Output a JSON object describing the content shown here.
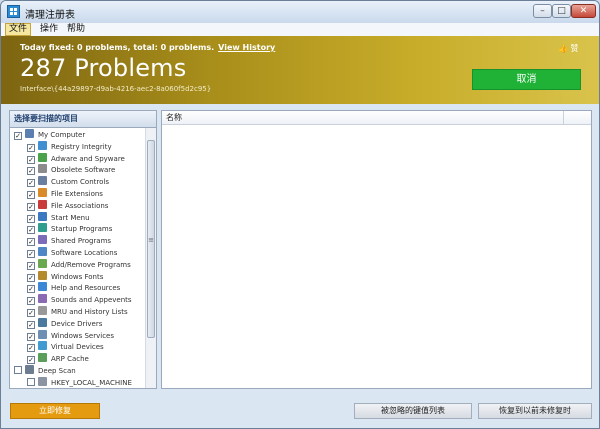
{
  "window": {
    "title": "清理注册表"
  },
  "menu": [
    "文件",
    "操作",
    "帮助"
  ],
  "banner": {
    "today_text": "Today fixed: 0 problems, total: 0 problems.",
    "view_history": "View History",
    "problems": "287 Problems",
    "interface": "Interface\\{44a29897-d9ab-4216-aec2-8a060f5d2c95}",
    "like": "赞",
    "cancel": "取消"
  },
  "left_panel": {
    "header": "选择要扫描的项目",
    "tree": [
      {
        "label": "My Computer",
        "level": 0,
        "checked": true,
        "icon": "computer-icon"
      },
      {
        "label": "Registry Integrity",
        "level": 1,
        "checked": true,
        "icon": "registry-icon"
      },
      {
        "label": "Adware and Spyware",
        "level": 1,
        "checked": true,
        "icon": "bug-icon"
      },
      {
        "label": "Obsolete Software",
        "level": 1,
        "checked": true,
        "icon": "package-icon"
      },
      {
        "label": "Custom Controls",
        "level": 1,
        "checked": true,
        "icon": "control-icon"
      },
      {
        "label": "File Extensions",
        "level": 1,
        "checked": true,
        "icon": "file-icon"
      },
      {
        "label": "File Associations",
        "level": 1,
        "checked": true,
        "icon": "pdf-icon"
      },
      {
        "label": "Start Menu",
        "level": 1,
        "checked": true,
        "icon": "start-menu-icon"
      },
      {
        "label": "Startup Programs",
        "level": 1,
        "checked": true,
        "icon": "startup-icon"
      },
      {
        "label": "Shared Programs",
        "level": 1,
        "checked": true,
        "icon": "shared-icon"
      },
      {
        "label": "Software Locations",
        "level": 1,
        "checked": true,
        "icon": "software-icon"
      },
      {
        "label": "Add/Remove Programs",
        "level": 1,
        "checked": true,
        "icon": "add-remove-icon"
      },
      {
        "label": "Windows Fonts",
        "level": 1,
        "checked": true,
        "icon": "font-icon"
      },
      {
        "label": "Help and Resources",
        "level": 1,
        "checked": true,
        "icon": "help-icon"
      },
      {
        "label": "Sounds and Appevents",
        "level": 1,
        "checked": true,
        "icon": "sound-icon"
      },
      {
        "label": "MRU and History Lists",
        "level": 1,
        "checked": true,
        "icon": "history-icon"
      },
      {
        "label": "Device Drivers",
        "level": 1,
        "checked": true,
        "icon": "driver-icon"
      },
      {
        "label": "Windows Services",
        "level": 1,
        "checked": true,
        "icon": "services-icon"
      },
      {
        "label": "Virtual Devices",
        "level": 1,
        "checked": true,
        "icon": "virtual-device-icon"
      },
      {
        "label": "ARP Cache",
        "level": 1,
        "checked": true,
        "icon": "network-icon"
      },
      {
        "label": "Deep Scan",
        "level": 0,
        "checked": false,
        "icon": "deep-scan-icon"
      },
      {
        "label": "HKEY_LOCAL_MACHINE",
        "level": 1,
        "checked": false,
        "icon": "hive-icon"
      }
    ]
  },
  "right_panel": {
    "column": "名称"
  },
  "buttons": {
    "repair": "立即修复",
    "ignored": "被忽略的键值列表",
    "restore": "恢复到以前未修复时"
  },
  "colors": {
    "banner": "#a88e1a",
    "cancel": "#1fb236",
    "repair": "#e49b0f"
  }
}
